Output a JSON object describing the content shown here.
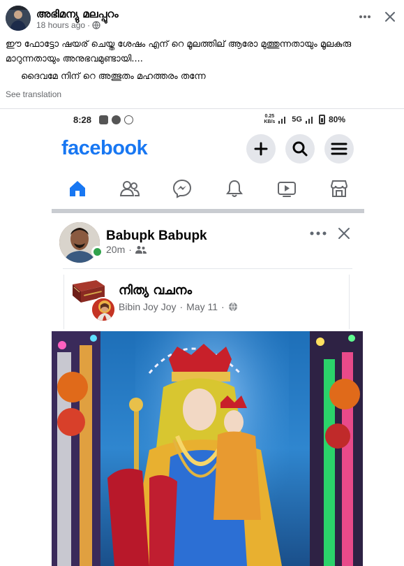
{
  "post": {
    "author_name": "അഭിമന്യു മലപ്പുറം",
    "timestamp": "18 hours ago",
    "audience_icon": "globe-icon",
    "text_line1": "ഈ ഫോട്ടോ ഷയര് ചെയ്ത ശേഷം എന് റെ മൂലത്തില് ആരോ മുത്തുന്നതായും മൂലകുരു മാറുന്നതായും അനുഭവമുണ്ടായി....",
    "text_line2": "ദൈവമേ നിന് റെ അത്ഭുതം മഹത്തരം തന്നേ",
    "see_translation": "See translation"
  },
  "screenshot": {
    "status_bar": {
      "time": "8:28",
      "speed_value": "0.25",
      "speed_unit": "KB/s",
      "network": "5G",
      "battery": "80%"
    },
    "app_logo": "facebook",
    "top_actions": [
      "add-icon",
      "search-icon",
      "menu-icon"
    ],
    "nav_icons": [
      "home-icon",
      "friends-icon",
      "messenger-icon",
      "notifications-icon",
      "watch-icon",
      "marketplace-icon"
    ],
    "inner_post": {
      "author_name": "Babupk Babupk",
      "timestamp": "20m",
      "shared": {
        "title": "നിത്യ വചനം",
        "author": "Bibin Joy Joy",
        "date": "May 11"
      }
    }
  },
  "colors": {
    "facebook_blue": "#1877f2",
    "online_green": "#31a24c",
    "meta_gray": "#65676b"
  }
}
